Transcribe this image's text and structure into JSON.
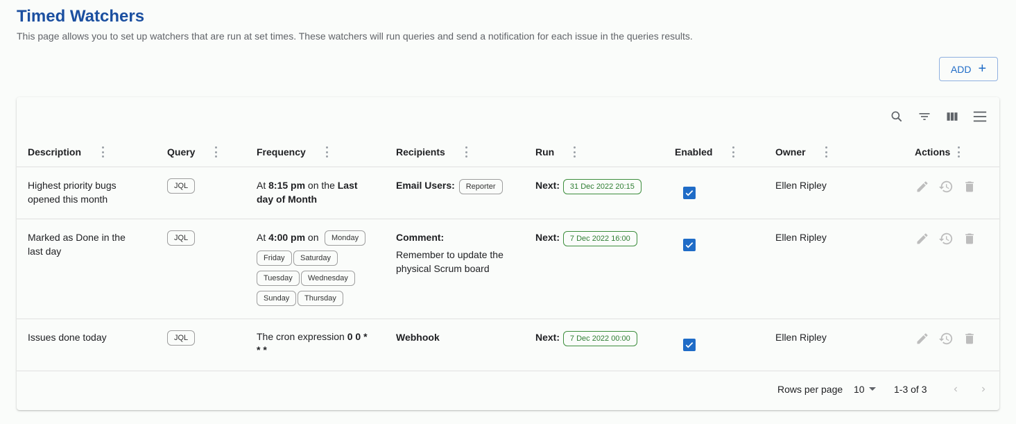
{
  "header": {
    "title": "Timed Watchers",
    "description": "This page allows you to set up watchers that are run at set times. These watchers will run queries and send a notification for each issue in the queries results.",
    "add_label": "ADD"
  },
  "table": {
    "columns": [
      "Description",
      "Query",
      "Frequency",
      "Recipients",
      "Run",
      "Enabled",
      "Owner",
      "Actions"
    ],
    "rows": [
      {
        "description": [
          "Highest priority bugs",
          "opened this month"
        ],
        "query": "JQL",
        "freq": {
          "pre": "At ",
          "time": "8:15 pm",
          "mid": " on the ",
          "rest1": "Last",
          "rest2": "day of Month"
        },
        "recipients": {
          "label": "Email Users:",
          "chip": "Reporter"
        },
        "run": {
          "label": "Next:",
          "value": "31 Dec 2022 20:15"
        },
        "enabled": true,
        "owner": "Ellen Ripley"
      },
      {
        "description": [
          "Marked as Done in the",
          "last day"
        ],
        "query": "JQL",
        "freq": {
          "pre": "At ",
          "time": "4:00 pm",
          "mid": " on",
          "days": [
            "Monday",
            "Friday",
            "Saturday",
            "Tuesday",
            "Wednesday",
            "Sunday",
            "Thursday"
          ]
        },
        "recipients": {
          "label": "Comment:",
          "text1": "Remember to update the",
          "text2": "physical Scrum board"
        },
        "run": {
          "label": "Next:",
          "value": "7 Dec 2022 16:00"
        },
        "enabled": true,
        "owner": "Ellen Ripley"
      },
      {
        "description": [
          "Issues done today"
        ],
        "query": "JQL",
        "freq": {
          "pre": "The cron expression ",
          "expr1": "0 0 *",
          "expr2": "* *"
        },
        "recipients": {
          "label": "Webhook"
        },
        "run": {
          "label": "Next:",
          "value": "7 Dec 2022 00:00"
        },
        "enabled": true,
        "owner": "Ellen Ripley"
      }
    ]
  },
  "footer": {
    "rows_per_page_label": "Rows per page",
    "rows_per_page_value": "10",
    "range": "1-3 of 3"
  },
  "icons": [
    "search-icon",
    "filter-icon",
    "columns-icon",
    "density-icon",
    "edit-icon",
    "history-icon",
    "delete-icon",
    "chevron-left-icon",
    "chevron-right-icon",
    "dropdown-arrow-icon",
    "plus-icon",
    "check-icon"
  ],
  "colors": {
    "title": "#1b4fa0",
    "accent": "#1f6cc7",
    "green": "#2e7d32",
    "muted_icon": "#bdbdbd"
  }
}
